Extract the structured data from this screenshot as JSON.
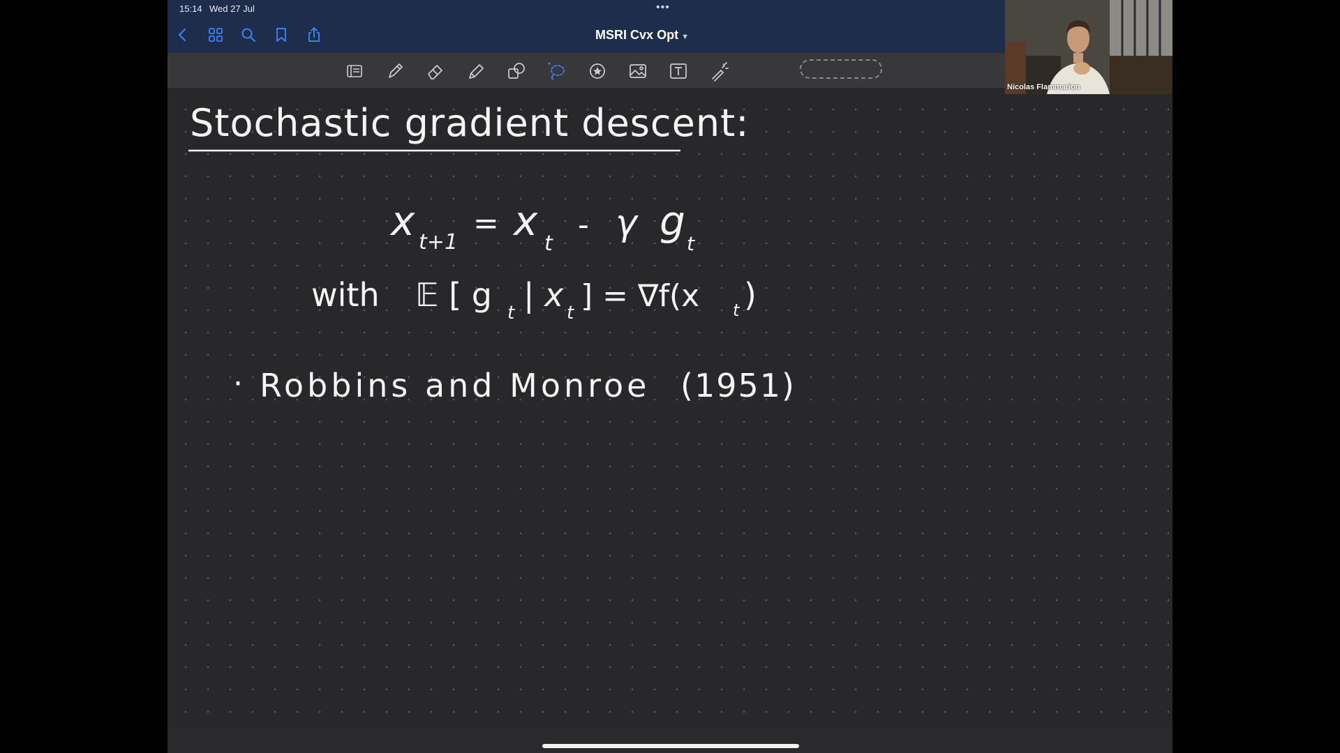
{
  "status_bar": {
    "time": "15:14",
    "date": "Wed 27 Jul"
  },
  "document": {
    "title": "MSRI Cvx Opt"
  },
  "nav_icons": [
    "back-chevron-icon",
    "thumbnails-grid-icon",
    "search-icon",
    "bookmark-icon",
    "share-icon"
  ],
  "toolbar": {
    "tools": [
      "read-mode-icon",
      "pen-icon",
      "eraser-icon",
      "highlighter-icon",
      "shapes-icon",
      "lasso-icon",
      "elements-icon",
      "image-icon",
      "text-box-icon",
      "laser-pointer-icon"
    ],
    "selected_tool": "lasso-icon"
  },
  "notes": {
    "heading": "Stochastic gradient descent:",
    "equation": {
      "lhs": "x",
      "lhs_sub": "t+1",
      "equals": "=",
      "x": "x",
      "x_sub": "t",
      "minus": "-",
      "gamma": "γ",
      "g": "g",
      "g_sub": "t"
    },
    "condition": {
      "with": "with",
      "expectation": "𝔼 [ g",
      "g_sub": "t",
      "bar_x": "| x",
      "x_sub": "t",
      "rhs": "] = ∇f(x",
      "rhs_sub": "t",
      "close": ")"
    },
    "bullet": "·",
    "reference": "Robbins and Monroe",
    "year": "(1951)"
  },
  "video": {
    "participant_name": "Nicolas Flammarion"
  },
  "colors": {
    "nav_bar": "#1e2d4c",
    "toolbar": "#38383b",
    "page": "#28282b",
    "ink": "#f5f5f5",
    "accent": "#3b82f6"
  }
}
